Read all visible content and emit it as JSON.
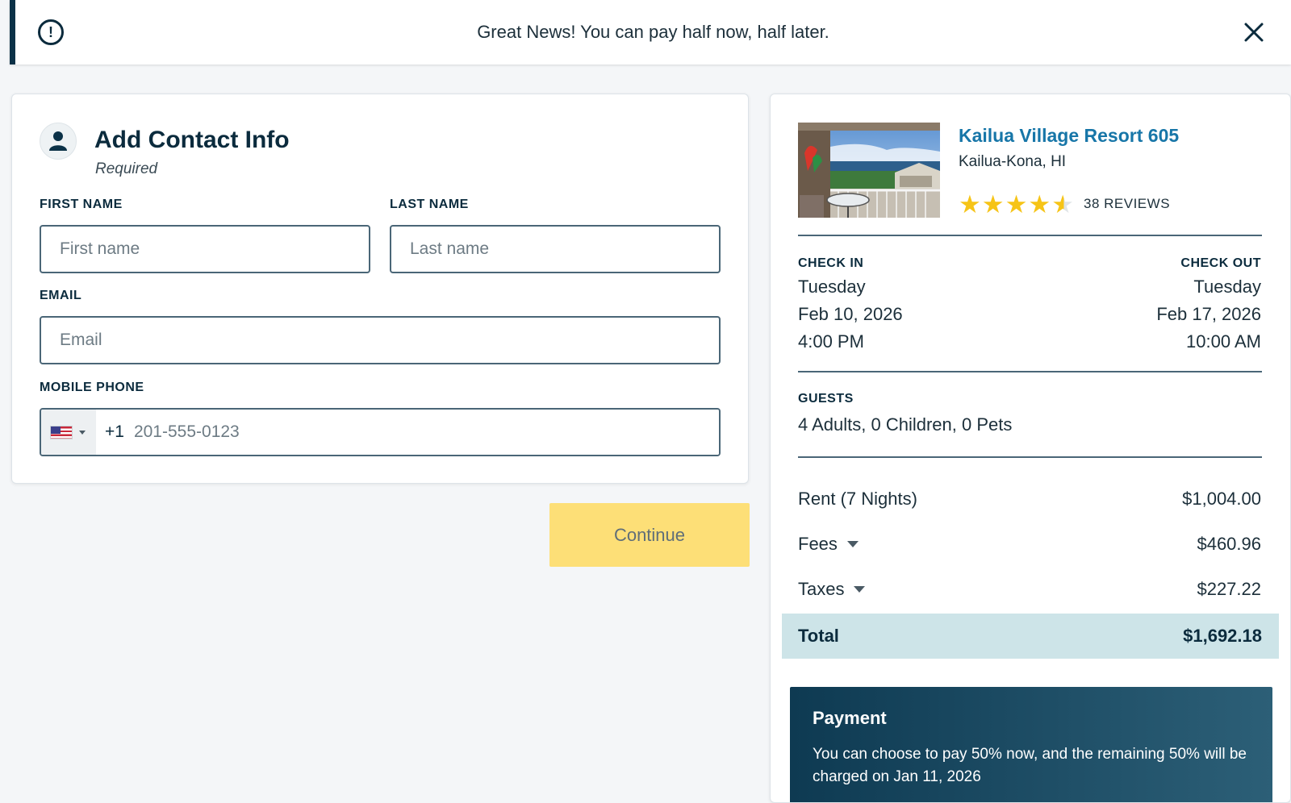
{
  "banner": {
    "message": "Great News! You can pay half now, half later.",
    "info_icon": "info-icon",
    "close_icon": "close-icon"
  },
  "contact": {
    "title": "Add Contact Info",
    "subtitle": "Required",
    "first_name_label": "FIRST NAME",
    "first_name_placeholder": "First name",
    "first_name_value": "",
    "last_name_label": "LAST NAME",
    "last_name_placeholder": "Last name",
    "last_name_value": "",
    "email_label": "EMAIL",
    "email_placeholder": "Email",
    "email_value": "",
    "phone_label": "MOBILE PHONE",
    "phone_country_code": "+1",
    "phone_country": "us-flag-icon",
    "phone_placeholder": "201-555-0123",
    "phone_value": ""
  },
  "continue_label": "Continue",
  "summary": {
    "property_name": "Kailua Village Resort 605",
    "property_location": "Kailua-Kona, HI",
    "rating": 4.5,
    "rating_max": 5,
    "reviews": "38 REVIEWS",
    "check_in_label": "CHECK IN",
    "check_in_day": "Tuesday",
    "check_in_date": "Feb 10, 2026",
    "check_in_time": "4:00 PM",
    "check_out_label": "CHECK OUT",
    "check_out_day": "Tuesday",
    "check_out_date": "Feb 17, 2026",
    "check_out_time": "10:00 AM",
    "guests_label": "GUESTS",
    "guests_value": "4 Adults, 0 Children, 0 Pets",
    "rent_label": "Rent (7 Nights)",
    "rent_value": "$1,004.00",
    "fees_label": "Fees",
    "fees_value": "$460.96",
    "taxes_label": "Taxes",
    "taxes_value": "$227.22",
    "total_label": "Total",
    "total_value": "$1,692.18"
  },
  "payment": {
    "title": "Payment",
    "text": "You can choose to pay 50% now, and the remaining 50% will be charged on Jan 11, 2026"
  },
  "colors": {
    "banner_accent": "#0b3147",
    "link": "#1776a8",
    "continue_bg": "#fddf77",
    "total_bg": "#cde4e8",
    "star": "#f6c417",
    "payment_bg": "#0e3a52"
  }
}
